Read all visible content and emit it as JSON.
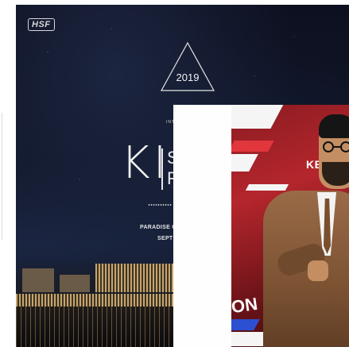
{
  "poster": {
    "logo_text": "HSF",
    "year": "2019",
    "intro_text": "INT",
    "title_main": "KI",
    "title_side_line1": "S",
    "title_side_line2": "F",
    "dots_text": "oooooooooo",
    "venue_text": "PARADISE C",
    "date_text": "SEPT"
  },
  "photo": {
    "backdrop_text_top": "KB",
    "backdrop_text_bottom": "ON"
  },
  "colors": {
    "poster_bg": "#111729",
    "overlay_white": "#fefefe",
    "backdrop_red": "#b4262c",
    "jacket_brown": "#7a5132"
  }
}
